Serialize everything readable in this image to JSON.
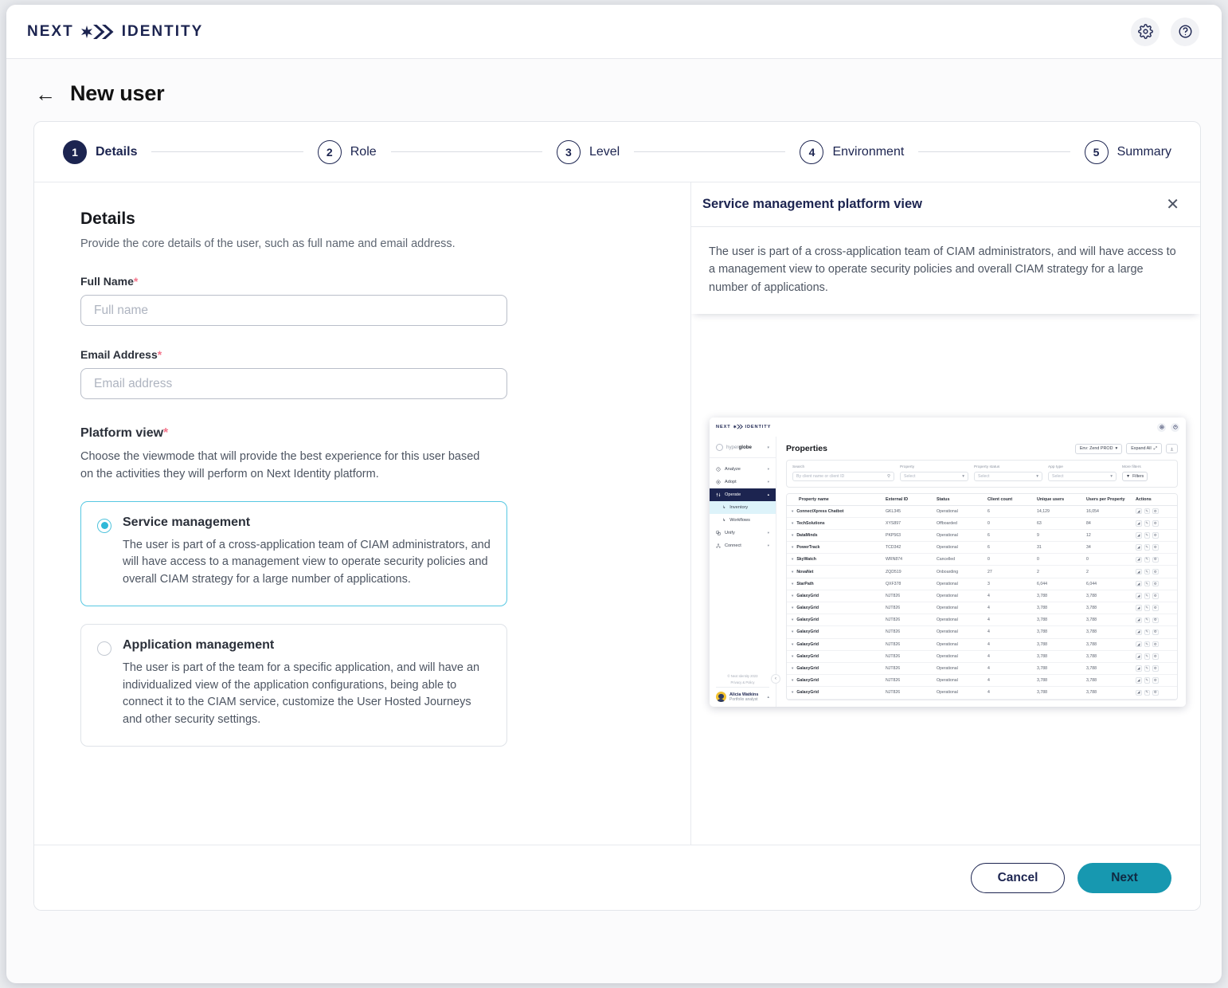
{
  "topbar": {
    "logo_text_left": "NEXT",
    "logo_text_right": "IDENTITY",
    "settings_icon": "gear-icon",
    "help_icon": "help-circle-icon"
  },
  "page": {
    "back_icon": "arrow-left-icon",
    "title": "New user"
  },
  "stepper": {
    "steps": [
      {
        "num": "1",
        "label": "Details",
        "active": true
      },
      {
        "num": "2",
        "label": "Role",
        "active": false
      },
      {
        "num": "3",
        "label": "Level",
        "active": false
      },
      {
        "num": "4",
        "label": "Environment",
        "active": false
      },
      {
        "num": "5",
        "label": "Summary",
        "active": false
      }
    ]
  },
  "details": {
    "title": "Details",
    "subtitle": "Provide the core details of the user, such as full name and email address.",
    "full_name_label": "Full Name",
    "full_name_value": "",
    "full_name_placeholder": "Full name",
    "email_label": "Email Address",
    "email_value": "",
    "email_placeholder": "Email address",
    "required_mark": "*"
  },
  "platform_view": {
    "title": "Platform view",
    "required_mark": "*",
    "description": "Choose the viewmode that will provide the best experience for this user based on the activities they will perform on Next Identity platform.",
    "options": [
      {
        "id": "service-management",
        "title": "Service management",
        "description": "The user is part of a cross-application team of CIAM administrators, and will have access to a management view to operate security policies and overall CIAM strategy for a large number of applications.",
        "selected": true
      },
      {
        "id": "application-management",
        "title": "Application management",
        "description": "The user is part of the team for a specific application, and will have an individualized view of the application configurations, being able to connect it to the CIAM service, customize the User Hosted Journeys and other security settings.",
        "selected": false
      }
    ]
  },
  "right_panel": {
    "title": "Service management platform view",
    "close_icon": "close-icon",
    "tooltip": "The user is part of a cross-application team of CIAM administrators, and will have access to a management view to operate security policies and overall CIAM strategy for a large number of applications."
  },
  "preview": {
    "logo_left": "NEXT",
    "logo_right": "IDENTITY",
    "org_name_light": "hyper",
    "org_name_bold": "globe",
    "org_caret": "chevron-down-icon",
    "nav": [
      {
        "label": "Analyze",
        "icon": "clock-icon",
        "state": "default"
      },
      {
        "label": "Adopt",
        "icon": "target-icon",
        "state": "default"
      },
      {
        "label": "Operate",
        "icon": "sliders-icon",
        "state": "active"
      },
      {
        "label": "Inventory",
        "icon": "arrow-sub-icon",
        "state": "selected-sub"
      },
      {
        "label": "Workflows",
        "icon": "arrow-sub-icon",
        "state": "sub"
      },
      {
        "label": "Unify",
        "icon": "merge-icon",
        "state": "default"
      },
      {
        "label": "Connect",
        "icon": "network-icon",
        "state": "default"
      }
    ],
    "footer_copyright": "© Next Identity 2023",
    "footer_privacy": "Privacy & Policy",
    "user_name": "Alicia Watkins",
    "user_role": "Portfolio analyst",
    "page_title": "Properties",
    "env_button": "Env: Zend PROD",
    "expand_button": "Expand All",
    "export_icon": "download-icon",
    "filters": [
      {
        "label": "Search",
        "placeholder": "By client name or client ID",
        "icon": "search-icon"
      },
      {
        "label": "Property",
        "placeholder": "Select",
        "icon": "chevron-down-icon"
      },
      {
        "label": "Property status",
        "placeholder": "Select",
        "icon": "chevron-down-icon"
      },
      {
        "label": "App type",
        "placeholder": "Select",
        "icon": "chevron-down-icon"
      }
    ],
    "more_filters_label": "More filters",
    "filters_button": "Filters",
    "table": {
      "columns": [
        "Property name",
        "External ID",
        "Status",
        "Client count",
        "Unique users",
        "Users per Property",
        "Actions"
      ],
      "rows": [
        {
          "name": "ConnectXpress Chatbot",
          "ext": "GKL345",
          "status": "Operational",
          "clients": "6",
          "unique": "14,129",
          "upp": "16,054"
        },
        {
          "name": "TechSolutions",
          "ext": "XYS897",
          "status": "Offboarded",
          "clients": "0",
          "unique": "63",
          "upp": "84"
        },
        {
          "name": "DataMinds",
          "ext": "PKP563",
          "status": "Operational",
          "clients": "6",
          "unique": "9",
          "upp": "12"
        },
        {
          "name": "PowerTrack",
          "ext": "TCD342",
          "status": "Operational",
          "clients": "6",
          "unique": "31",
          "upp": "34"
        },
        {
          "name": "SkyWatch",
          "ext": "WRN874",
          "status": "Cancelled",
          "clients": "0",
          "unique": "0",
          "upp": "0"
        },
        {
          "name": "NovaNet",
          "ext": "ZQD519",
          "status": "Onboarding",
          "clients": "27",
          "unique": "2",
          "upp": "2"
        },
        {
          "name": "StarPath",
          "ext": "QXF378",
          "status": "Operational",
          "clients": "3",
          "unique": "6,044",
          "upp": "6,044"
        },
        {
          "name": "GalaxyGrid",
          "ext": "NJT826",
          "status": "Operational",
          "clients": "4",
          "unique": "3,788",
          "upp": "3,788"
        },
        {
          "name": "GalaxyGrid",
          "ext": "NJT826",
          "status": "Operational",
          "clients": "4",
          "unique": "3,788",
          "upp": "3,788"
        },
        {
          "name": "GalaxyGrid",
          "ext": "NJT826",
          "status": "Operational",
          "clients": "4",
          "unique": "3,788",
          "upp": "3,788"
        },
        {
          "name": "GalaxyGrid",
          "ext": "NJT826",
          "status": "Operational",
          "clients": "4",
          "unique": "3,788",
          "upp": "3,788"
        },
        {
          "name": "GalaxyGrid",
          "ext": "NJT826",
          "status": "Operational",
          "clients": "4",
          "unique": "3,788",
          "upp": "3,788"
        },
        {
          "name": "GalaxyGrid",
          "ext": "NJT826",
          "status": "Operational",
          "clients": "4",
          "unique": "3,788",
          "upp": "3,788"
        },
        {
          "name": "GalaxyGrid",
          "ext": "NJT826",
          "status": "Operational",
          "clients": "4",
          "unique": "3,788",
          "upp": "3,788"
        },
        {
          "name": "GalaxyGrid",
          "ext": "NJT826",
          "status": "Operational",
          "clients": "4",
          "unique": "3,788",
          "upp": "3,788"
        },
        {
          "name": "GalaxyGrid",
          "ext": "NJT826",
          "status": "Operational",
          "clients": "4",
          "unique": "3,788",
          "upp": "3,788"
        }
      ]
    }
  },
  "footer": {
    "cancel_label": "Cancel",
    "next_label": "Next"
  },
  "colors": {
    "brand_navy": "#1c2450",
    "accent_teal": "#1798b0",
    "radio_teal": "#2fb8d8",
    "required_red": "#f4768c",
    "selected_border": "#57c8e2"
  }
}
